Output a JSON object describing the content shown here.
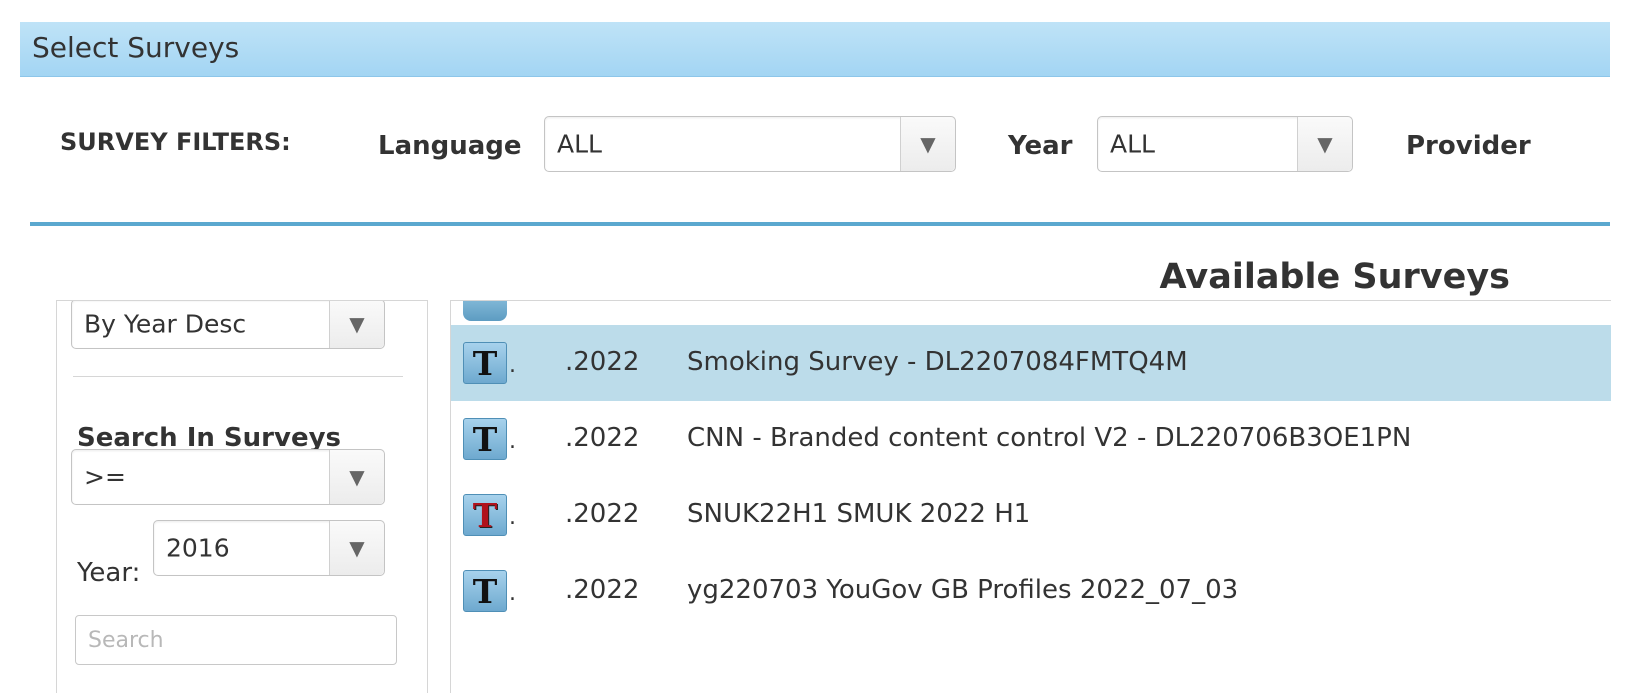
{
  "window": {
    "title": "Select Surveys"
  },
  "filters": {
    "label": "SURVEY FILTERS:",
    "language": {
      "label": "Language",
      "value": "ALL"
    },
    "year": {
      "label": "Year",
      "value": "ALL"
    },
    "provider": {
      "label": "Provider"
    }
  },
  "available": {
    "title": "Available Surveys"
  },
  "sidebar": {
    "sort_value": "By Year Desc",
    "search_heading": "Search In Surveys",
    "operator_value": ">=",
    "year_label": "Year:",
    "year_value": "2016",
    "search_placeholder": "Search"
  },
  "surveys": [
    {
      "icon": "T",
      "dot": ".",
      "year": ".2022",
      "name": "Smoking Survey - DL2207084FMTQ4M",
      "selected": true,
      "icon_color": "#111111"
    },
    {
      "icon": "T",
      "dot": ".",
      "year": ".2022",
      "name": "CNN - Branded content control V2 - DL220706B3OE1PN",
      "selected": false,
      "icon_color": "#111111"
    },
    {
      "icon": "T",
      "dot": ".",
      "year": ".2022",
      "name": "SNUK22H1 SMUK 2022 H1",
      "selected": false,
      "icon_color": "#b0121c"
    },
    {
      "icon": "T",
      "dot": ".",
      "year": ".2022",
      "name": "yg220703 YouGov GB Profiles 2022_07_03",
      "selected": false,
      "icon_color": "#111111"
    }
  ],
  "colors": {
    "title_bar": "#a3d5f3",
    "divider": "#5ba8cf",
    "selected_row": "#bcdcea"
  }
}
